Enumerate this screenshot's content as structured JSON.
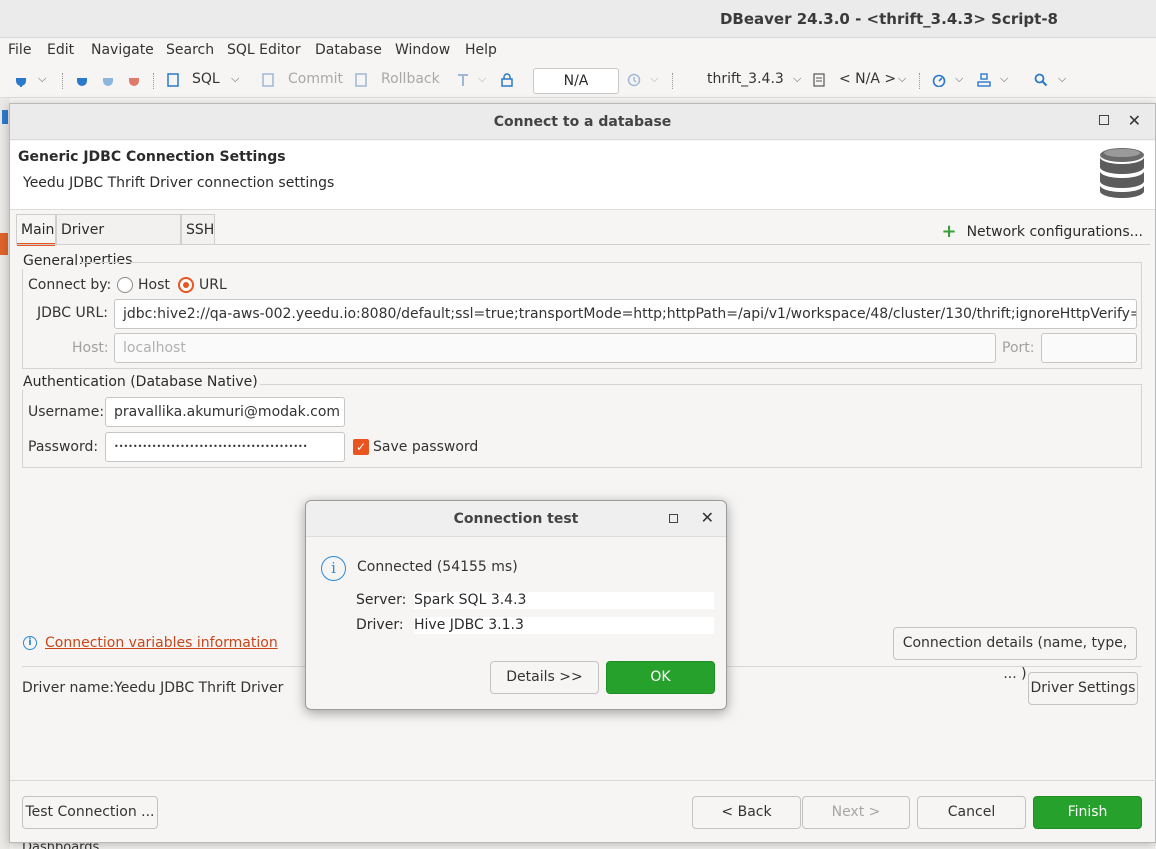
{
  "window": {
    "title": "DBeaver 24.3.0 - <thrift_3.4.3> Script-8"
  },
  "menu": [
    "File",
    "Edit",
    "Navigate",
    "Search",
    "SQL Editor",
    "Database",
    "Window",
    "Help"
  ],
  "toolbar": {
    "sql": "SQL",
    "commit": "Commit",
    "rollback": "Rollback",
    "na_box": "N/A",
    "datasource": "thrift_3.4.3",
    "schema": "< N/A >"
  },
  "background": {
    "dashboards": "Dashboards"
  },
  "dialog": {
    "title": "Connect to a database",
    "header_title": "Generic JDBC Connection Settings",
    "header_subtitle": "Yeedu JDBC Thrift Driver connection settings",
    "tabs": [
      "Main",
      "Driver properties",
      "SSH"
    ],
    "network_configurations": "Network configurations...",
    "general": {
      "label": "General",
      "connect_by": "Connect by:",
      "host_option": "Host",
      "url_option": "URL",
      "jdbc_url_label": "JDBC URL:",
      "jdbc_url_value": "jdbc:hive2://qa-aws-002.yeedu.io:8080/default;ssl=true;transportMode=http;httpPath=/api/v1/workspace/48/cluster/130/thrift;ignoreHttpVerify=true",
      "host_label": "Host:",
      "host_placeholder": "localhost",
      "port_label": "Port:",
      "port_value": ""
    },
    "auth": {
      "label": "Authentication (Database Native)",
      "username_label": "Username:",
      "username_value": "pravallika.akumuri@modak.com",
      "password_label": "Password:",
      "password_value": "•••••••••••••••••••••••••••••••••••••••••",
      "save_password": "Save password"
    },
    "connection_variables": "Connection variables information",
    "connection_details": "Connection details (name, type, ... )",
    "driver_name_label": "Driver name:",
    "driver_name_value": "Yeedu JDBC Thrift Driver",
    "driver_settings": "Driver Settings",
    "buttons": {
      "test_connection": "Test Connection ...",
      "back": "< Back",
      "next": "Next >",
      "cancel": "Cancel",
      "finish": "Finish"
    }
  },
  "popup": {
    "title": "Connection test",
    "message": "Connected (54155 ms)",
    "server_label": "Server:",
    "server_value": "Spark SQL 3.4.3",
    "driver_label": "Driver:",
    "driver_value": "Hive JDBC 3.1.3",
    "details_button": "Details >>",
    "ok_button": "OK"
  },
  "colors": {
    "accent": "#e95420",
    "green": "#26a22c",
    "info_blue": "#2b8ad8",
    "link": "#c8461a"
  }
}
